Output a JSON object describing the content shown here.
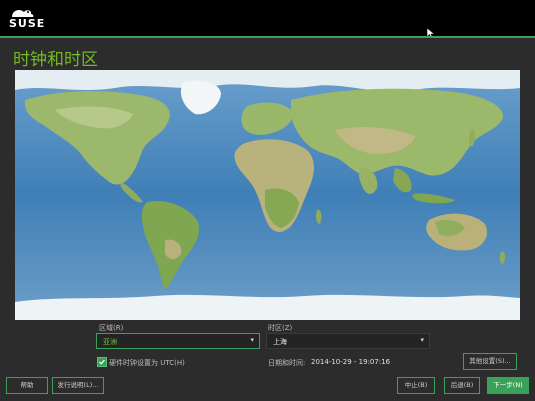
{
  "brand": {
    "name": "SUSE"
  },
  "page": {
    "title": "时钟和时区"
  },
  "region": {
    "label": "区域(R)",
    "value": "亚洲"
  },
  "timezone": {
    "label": "时区(Z)",
    "value": "上海"
  },
  "hwclock": {
    "label": "硬件时钟设置为 UTC(H)",
    "checked": true
  },
  "datetime": {
    "label": "日期和时间:",
    "value": "2014-10-29 - 19:07:16"
  },
  "buttons": {
    "other_settings": "其他设置(S)...",
    "help": "帮助",
    "release_notes": "发行说明(L)...",
    "abort": "中止(B)",
    "back": "后退(B)",
    "next": "下一步(N)"
  },
  "colors": {
    "accent": "#3aa15a",
    "title": "#73ba25",
    "background": "#2b2c2b",
    "ocean": "#4a86b8",
    "land": "#8fb060"
  }
}
